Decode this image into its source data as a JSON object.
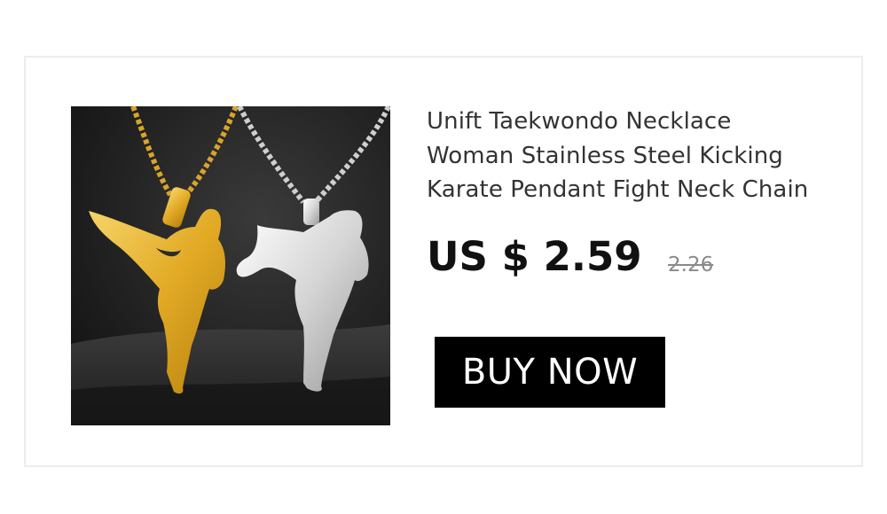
{
  "product": {
    "image_alt_name": "product-photo",
    "title_lines": [
      "Unift Taekwondo Necklace",
      "Woman Stainless Steel Kicking",
      "Karate Pendant Fight Neck Chain"
    ],
    "price": "US $ 2.59",
    "original_price": "2.26"
  },
  "actions": {
    "buy_label": "BUY NOW"
  },
  "colors": {
    "button_background": "#000000",
    "button_text": "#ffffff",
    "gold_pendant": "#e8b530",
    "silver_pendant": "#d9d9d9",
    "photo_background": "#222222"
  }
}
